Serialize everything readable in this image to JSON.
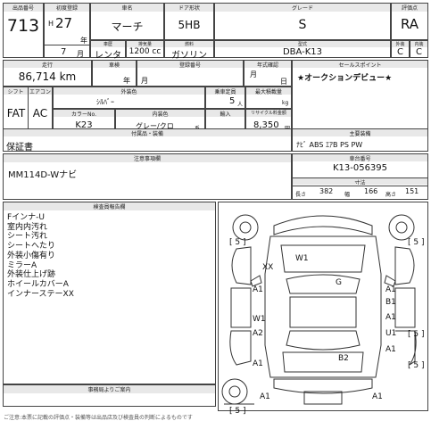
{
  "header": {
    "lot_label": "出品番号",
    "lot_value": "713",
    "first_reg_label": "初度登録",
    "era": "H",
    "year": "27",
    "year_suffix": "年",
    "month": "7",
    "month_suffix": "月",
    "name_label": "車名",
    "name_value": "マーチ",
    "door_label": "ドア形状",
    "door_value": "5HB",
    "grade_label": "グレード",
    "grade_value": "S",
    "score_label": "評価点",
    "score_value": "RA",
    "use_label": "車歴",
    "use_value": "レンタ",
    "disp_label": "排気量",
    "disp_value": "1200 cc",
    "fuel_label": "燃料",
    "fuel_value": "ガソリン",
    "model_label": "型式",
    "model_value": "DBA-K13",
    "ext_label": "外装",
    "ext_value": "C",
    "int_label": "内装",
    "int_value": "C"
  },
  "row2": {
    "mileage_label": "走行",
    "mileage_value": "86,714 km",
    "inspection_label": "車検",
    "insp_year": "年",
    "insp_month": "月",
    "regnum_label": "登録番号",
    "mfg_label": "年式確認",
    "mfg_month": "月",
    "mfg_day": "日",
    "sales_label": "セールスポイント",
    "sales_value": "★オークションデビュー★"
  },
  "row3": {
    "shift_label": "シフト",
    "ac_label": "エアコン",
    "shift_value": "FAT",
    "ac_value": "AC",
    "extcolor_label": "外装色",
    "extcolor_value": "ｼﾙﾊﾞｰ",
    "color_no_label": "カラーNo.",
    "color_no_value": "K23",
    "intcolor_label": "内装色",
    "intcolor_value": "グレー/クロ",
    "intcolor_suffix": "系",
    "capacity_label": "乗車定員",
    "capacity_value": "5",
    "capacity_unit": "人",
    "load_label": "最大積載量",
    "load_unit": "kg",
    "import_label": "輸入",
    "recycle_label": "リサイクル料金額",
    "recycle_value": "8,350",
    "recycle_unit": "円"
  },
  "row4": {
    "equip_label": "付属品・装備",
    "warranty": "保証書",
    "options_label": "主要装備",
    "options_value": "ﾅﾋﾞ ABS ｴｱB PS PW"
  },
  "notes": {
    "label": "注意事項欄",
    "value": "MM114D-Wナビ",
    "chassis_label": "車台番号",
    "chassis_value": "K13-056395",
    "dims_label": "寸法",
    "len_label": "長さ",
    "len_value": "382",
    "wid_label": "幅",
    "wid_value": "166",
    "hei_label": "高さ",
    "hei_value": "151"
  },
  "inspector": {
    "label": "検査員報告欄",
    "items": [
      "Fインナ-U",
      "室内内汚れ",
      "シート汚れ",
      "シートへたり",
      "外装小傷有り",
      "ミラーA",
      "外装仕上げ跡",
      "ホイールカバーA",
      "インナーステーXX"
    ]
  },
  "office_label": "事務局よりご案内",
  "footer_text": "ご注意:本票に記載の評価点・装備等は出品店及び検査員の判断によるものです",
  "diagram": {
    "marks": [
      "W1",
      "XX",
      "A1",
      "A1",
      "G",
      "A1",
      "B1",
      "W1",
      "A2",
      "A1",
      "U1",
      "A1",
      "B2",
      "A1",
      "A1"
    ],
    "brackets": [
      "[ 5 ]",
      "[ 5 ]",
      "[ 5 ]",
      "[ 5 ]",
      "[ 5 ]"
    ]
  }
}
